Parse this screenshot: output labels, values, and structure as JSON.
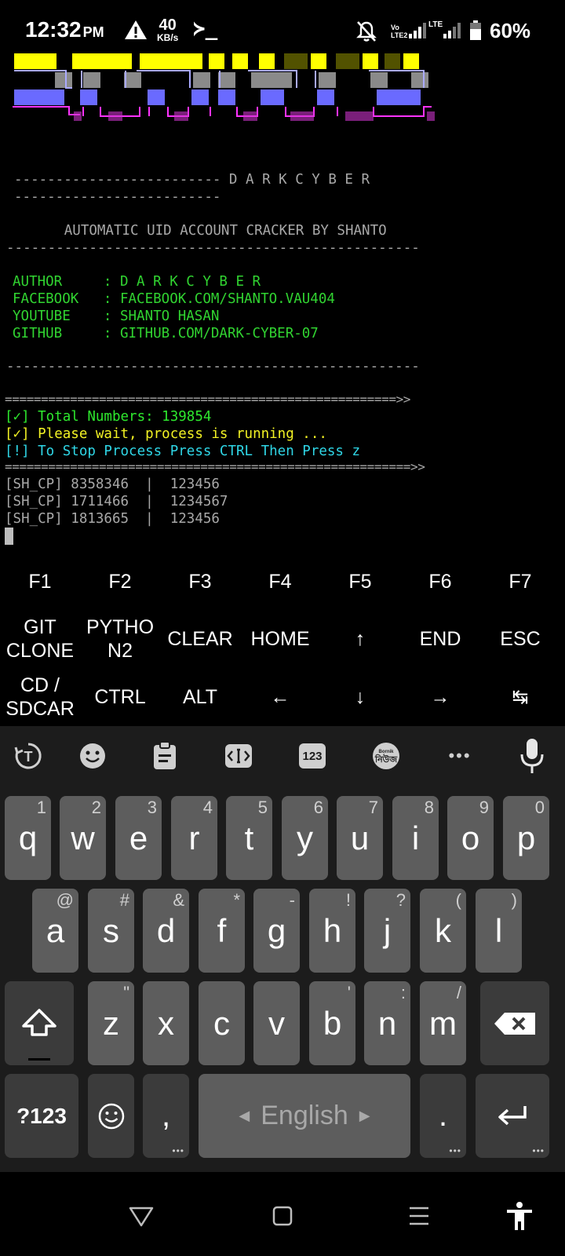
{
  "status_bar": {
    "time": "12:32",
    "ampm": "PM",
    "speed_value": "40",
    "speed_unit": "KB/s",
    "terminal_glyph": "≻_",
    "volte": "Vo LTE2",
    "lte": "LTE",
    "battery": "60%"
  },
  "terminal": {
    "brand_line_1": "------------------------- D A R K C Y B E R",
    "brand_line_2": "-------------------------",
    "tagline": "       AUTOMATIC UID ACCOUNT CRACKER BY SHANTO",
    "separator": "--------------------------------------------------",
    "info": [
      {
        "key": "AUTHOR     ",
        "value": ": D A R K C Y B E R"
      },
      {
        "key": "FACEBOOK   ",
        "value": ": FACEBOOK.COM/SHANTO.VAU404"
      },
      {
        "key": "YOUTUBE    ",
        "value": ": SHANTO HASAN"
      },
      {
        "key": "GITHUB     ",
        "value": ": GITHUB.COM/DARK-CYBER-07"
      }
    ],
    "rule_1": "======================================================>>",
    "status_total": "[✓] Total Numbers: 139854",
    "status_wait": "[✓] Please wait, process is running ...",
    "status_stop": "[!] To Stop Process Press CTRL Then Press z",
    "rule_2": "========================================================>>",
    "results": [
      "[SH_CP] 8358346  |  123456",
      "[SH_CP] 1711466  |  1234567",
      "[SH_CP] 1813665  |  123456"
    ]
  },
  "extra_keys": {
    "row1": [
      "F1",
      "F2",
      "F3",
      "F4",
      "F5",
      "F6",
      "F7"
    ],
    "row2": [
      "GIT CLONE",
      "PYTHON2",
      "CLEAR",
      "HOME",
      "↑",
      "END",
      "ESC"
    ],
    "row3": [
      "CD / SDCAR",
      "CTRL",
      "ALT",
      "←",
      "↓",
      "→",
      "↹"
    ]
  },
  "keyboard": {
    "toolbar": {
      "translate_glyph": "T",
      "clipboard_label": "",
      "numbers_label": "123",
      "language_badge_top": "Bornik",
      "language_badge_bottom": "নিউজ",
      "more_label": "•••"
    },
    "row1": [
      {
        "letter": "q",
        "hint": "1"
      },
      {
        "letter": "w",
        "hint": "2"
      },
      {
        "letter": "e",
        "hint": "3"
      },
      {
        "letter": "r",
        "hint": "4"
      },
      {
        "letter": "t",
        "hint": "5"
      },
      {
        "letter": "y",
        "hint": "6"
      },
      {
        "letter": "u",
        "hint": "7"
      },
      {
        "letter": "i",
        "hint": "8"
      },
      {
        "letter": "o",
        "hint": "9"
      },
      {
        "letter": "p",
        "hint": "0"
      }
    ],
    "row2": [
      {
        "letter": "a",
        "hint": "@"
      },
      {
        "letter": "s",
        "hint": "#"
      },
      {
        "letter": "d",
        "hint": "&"
      },
      {
        "letter": "f",
        "hint": "*"
      },
      {
        "letter": "g",
        "hint": "-"
      },
      {
        "letter": "h",
        "hint": "!"
      },
      {
        "letter": "j",
        "hint": "?"
      },
      {
        "letter": "k",
        "hint": "("
      },
      {
        "letter": "l",
        "hint": ")"
      }
    ],
    "row3": [
      {
        "letter": "z",
        "hint": "\""
      },
      {
        "letter": "x",
        "hint": ""
      },
      {
        "letter": "c",
        "hint": ""
      },
      {
        "letter": "v",
        "hint": ""
      },
      {
        "letter": "b",
        "hint": "'"
      },
      {
        "letter": "n",
        "hint": ":"
      },
      {
        "letter": "m",
        "hint": "/"
      }
    ],
    "symbols_label": "?123",
    "comma_label": ",",
    "space_label": "English",
    "period_label": ".",
    "key_dots": "•••"
  },
  "colors": {
    "terminal_bg": "#000000",
    "keyboard_bg": "#1c1c1c",
    "key_bg": "#5d5d5d",
    "key_dark_bg": "#3b3b3b",
    "text_green": "#2ee82e",
    "text_yellow": "#f2f224",
    "text_cyan": "#2fd6e6",
    "text_gray": "#a8a8a8"
  }
}
